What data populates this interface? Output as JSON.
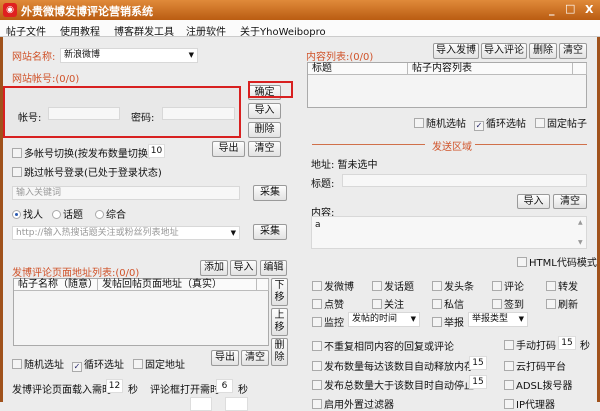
{
  "window": {
    "title": "外贵微博发博评论营销系统",
    "minimize": "_",
    "maximize": "□",
    "close": "X"
  },
  "menu": [
    "帖子文件",
    "使用教程",
    "博客群发工具",
    "注册软件",
    "关于YhoWeibopro"
  ],
  "account": {
    "site_label": "网站名称:",
    "site_value": "新浪微博",
    "account_label": "网站帐号:(0/0)",
    "user_label": "帐号:",
    "pass_label": "密码:",
    "confirm": "确定",
    "import": "导入",
    "delete": "删除",
    "export": "导出",
    "clear": "清空",
    "multi_switch": "多帐号切换(按发布数量切换)",
    "multi_count": "10",
    "skip_login": "跳过帐号登录(已处于登录状态)"
  },
  "collect": {
    "keyword_placeholder": "输入关键词",
    "collect": "采集",
    "radios": [
      "找人",
      "话题",
      "综合"
    ],
    "url_placeholder": "http://输入热搜话题关注或粉丝列表地址",
    "collect2": "采集"
  },
  "url_list": {
    "label": "发博评论页面地址列表:(0/0)",
    "add": "添加",
    "import": "导入",
    "edit": "编辑",
    "columns": [
      "帖子名称（随意）",
      "发帖回帖页面地址（真实）"
    ],
    "down": "下移",
    "up": "上移",
    "delete": "删除",
    "random": "随机选址",
    "loop": "循环选址",
    "fixed": "固定地址",
    "export": "导出",
    "clear": "清空"
  },
  "timing": {
    "load_label": "发博评论页面载入需时",
    "load_value": "12",
    "sec1": "秒",
    "open_label": "评论框打开需时",
    "open_value": "6",
    "sec2": "秒"
  },
  "content_list": {
    "label": "内容列表:(0/0)",
    "import_post": "导入发博",
    "import_comment": "导入评论",
    "delete": "删除",
    "clear": "清空",
    "columns": [
      "标题",
      "帖子内容列表"
    ],
    "random": "随机选帖",
    "loop": "循环选帖",
    "fixed": "固定帖子"
  },
  "send": {
    "section": "发送区域",
    "address": "地址: 暂未选中",
    "title_label": "标题:",
    "import": "导入",
    "clear": "清空",
    "content_label": "内容:",
    "content_value": "a",
    "html_mode": "HTML代码模式"
  },
  "actions": [
    [
      "发微博",
      "发话题",
      "发头条",
      "评论",
      "转发"
    ],
    [
      "点赞",
      "关注",
      "私信",
      "签到",
      "刷新"
    ]
  ],
  "monitor": {
    "label": "监控",
    "value": "发帖的时间",
    "report": "举报",
    "report_value": "举报类型"
  },
  "options": {
    "no_repeat": "不重复相同内容的回复或评论",
    "manual_captcha": "手动打码",
    "manual_value": "15",
    "sec": "秒",
    "release_mem": "发布数量每达该数目自动释放内存",
    "release_value": "15",
    "cloud_captcha": "云打码平台",
    "auto_stop": "发布总数量大于该数目时自动停止",
    "stop_value": "15",
    "adsl": "ADSL拨号器",
    "filter": "启用外置过滤器",
    "proxy": "IP代理器"
  }
}
